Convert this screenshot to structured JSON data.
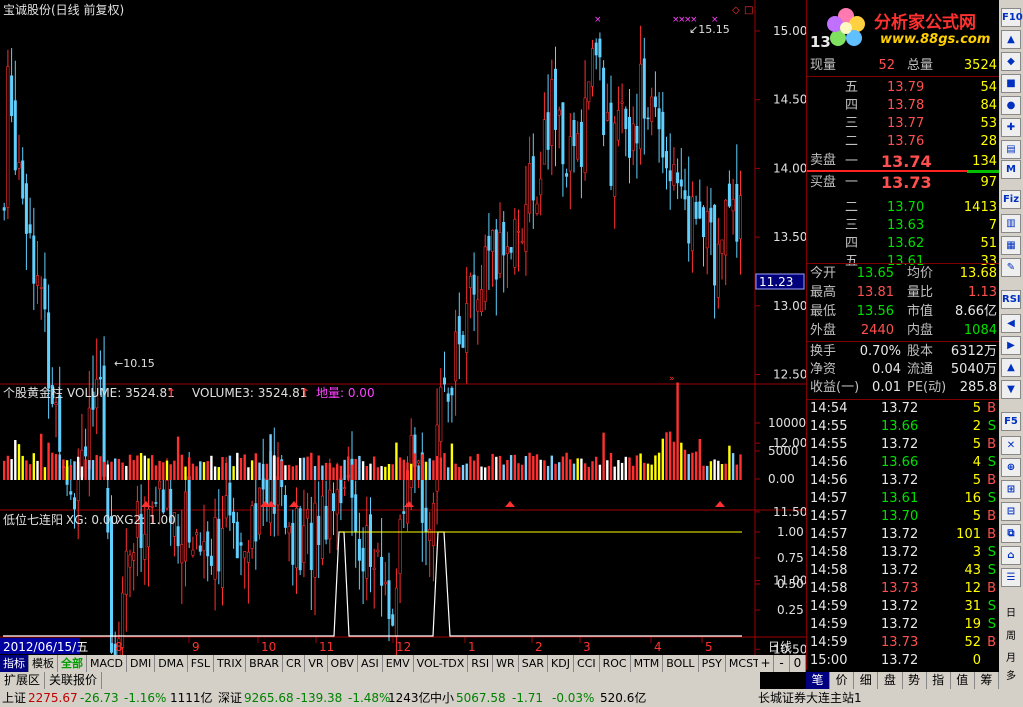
{
  "title": "宝诚股份(日线 前复权)",
  "logo": {
    "text": "分析家公式网",
    "url": "www.88gs.com"
  },
  "main_chart": {
    "price_axis": [
      "15.00",
      "14.50",
      "14.00",
      "13.50",
      "13.00",
      "12.50",
      "12.00",
      "11.50",
      "11.00",
      "10.50"
    ],
    "high_label": "15.15",
    "low_label": "10.15",
    "cursor_price": "11.23",
    "price_top": "13"
  },
  "volume_panel": {
    "label_name": "个股黄金柱",
    "label_vol": "VOLUME: 3524.81",
    "label_vol3": "VOLUME3: 3524.81",
    "label_dl": "地量: 0.00",
    "axis": [
      "10000",
      "5000",
      "0.00"
    ]
  },
  "indicator_panel": {
    "label": "低位七连阳",
    "label_xg": "XG: 0.00",
    "label_xg2": "XG2: 1.00",
    "axis": [
      "1.00",
      "0.75",
      "0.50",
      "0.25"
    ]
  },
  "date_axis": {
    "current_date": "2012/06/15/五",
    "ticks": [
      "8",
      "9",
      "10",
      "11",
      "12",
      "1",
      "2",
      "3",
      "4",
      "5"
    ],
    "period": "日线"
  },
  "chart_data": [
    {
      "type": "candlestick",
      "title": "宝诚股份(日线 前复权)",
      "ylim": [
        10.0,
        15.3
      ],
      "annotations": [
        "15.15",
        "10.15"
      ],
      "note_high": 15.15,
      "note_low": 10.15
    },
    {
      "type": "bar",
      "title": "个股黄金柱",
      "series": [
        {
          "name": "VOLUME",
          "last": 3524.81
        },
        {
          "name": "VOLUME3",
          "last": 3524.81
        },
        {
          "name": "地量",
          "last": 0.0
        }
      ],
      "ylim": [
        0,
        12000
      ]
    },
    {
      "type": "line",
      "title": "低位七连阳",
      "series": [
        {
          "name": "XG",
          "last": 0.0
        },
        {
          "name": "XG2",
          "last": 1.0
        }
      ],
      "ylim": [
        0,
        1.1
      ]
    }
  ],
  "quote": {
    "price_big": "13",
    "xianliang_label": "现量",
    "xianliang": "52",
    "zongliang_label": "总量",
    "zongliang": "3524",
    "sell": [
      {
        "level": "五",
        "price": "13.79",
        "vol": "54"
      },
      {
        "level": "四",
        "price": "13.78",
        "vol": "84"
      },
      {
        "level": "三",
        "price": "13.77",
        "vol": "53"
      },
      {
        "level": "二",
        "price": "13.76",
        "vol": "28"
      },
      {
        "level": "一",
        "price": "13.74",
        "vol": "134"
      }
    ],
    "sell_label": "卖盘",
    "buy_label": "买盘",
    "buy": [
      {
        "level": "一",
        "price": "13.73",
        "vol": "97"
      },
      {
        "level": "二",
        "price": "13.70",
        "vol": "1413"
      },
      {
        "level": "三",
        "price": "13.63",
        "vol": "7"
      },
      {
        "level": "四",
        "price": "13.62",
        "vol": "51"
      },
      {
        "level": "五",
        "price": "13.61",
        "vol": "33"
      }
    ],
    "stats": [
      {
        "l1": "今开",
        "v1": "13.65",
        "l2": "均价",
        "v2": "13.68"
      },
      {
        "l1": "最高",
        "v1": "13.81",
        "l2": "量比",
        "v2": "1.13"
      },
      {
        "l1": "最低",
        "v1": "13.56",
        "l2": "市值",
        "v2": "8.66亿"
      },
      {
        "l1": "外盘",
        "v1": "2440",
        "l2": "内盘",
        "v2": "1084"
      }
    ],
    "stats2": [
      {
        "l1": "换手",
        "v1": "0.70%",
        "l2": "股本",
        "v2": "6312万"
      },
      {
        "l1": "净资",
        "v1": "0.04",
        "l2": "流通",
        "v2": "5040万"
      },
      {
        "l1": "收益(一)",
        "v1": "0.01",
        "l2": "PE(动)",
        "v2": "285.8"
      }
    ],
    "ticks": [
      {
        "t": "14:54",
        "p": "13.72",
        "v": "5",
        "bs": "B"
      },
      {
        "t": "14:55",
        "p": "13.66",
        "v": "2",
        "bs": "S"
      },
      {
        "t": "14:55",
        "p": "13.72",
        "v": "5",
        "bs": "B"
      },
      {
        "t": "14:56",
        "p": "13.66",
        "v": "4",
        "bs": "S"
      },
      {
        "t": "14:56",
        "p": "13.72",
        "v": "5",
        "bs": "B"
      },
      {
        "t": "14:57",
        "p": "13.61",
        "v": "16",
        "bs": "S"
      },
      {
        "t": "14:57",
        "p": "13.70",
        "v": "5",
        "bs": "B"
      },
      {
        "t": "14:57",
        "p": "13.72",
        "v": "101",
        "bs": "B"
      },
      {
        "t": "14:58",
        "p": "13.72",
        "v": "3",
        "bs": "S"
      },
      {
        "t": "14:58",
        "p": "13.72",
        "v": "43",
        "bs": "S"
      },
      {
        "t": "14:58",
        "p": "13.73",
        "v": "12",
        "bs": "B"
      },
      {
        "t": "14:59",
        "p": "13.72",
        "v": "31",
        "bs": "S"
      },
      {
        "t": "14:59",
        "p": "13.72",
        "v": "19",
        "bs": "S"
      },
      {
        "t": "14:59",
        "p": "13.73",
        "v": "52",
        "bs": "B"
      },
      {
        "t": "15:00",
        "p": "13.72",
        "v": "0",
        "bs": ""
      }
    ]
  },
  "index_tabs": [
    "指标",
    "模板",
    "全部",
    "MACD",
    "DMI",
    "DMA",
    "FSL",
    "TRIX",
    "BRAR",
    "CR",
    "VR",
    "OBV",
    "ASI",
    "EMV",
    "VOL-TDX",
    "RSI",
    "WR",
    "SAR",
    "KDJ",
    "CCI",
    "ROC",
    "MTM",
    "BOLL",
    "PSY",
    "MCST"
  ],
  "zoom": [
    "+",
    "-",
    "0"
  ],
  "ext_tabs": [
    "扩展区",
    "关联报价"
  ],
  "right_tabs": [
    "笔",
    "价",
    "细",
    "盘",
    "势",
    "指",
    "值",
    "筹"
  ],
  "icons": [
    "F10",
    "M",
    "RSI",
    "Fiz",
    "F5",
    "日",
    "周",
    "月",
    "多"
  ],
  "status": {
    "sh_label": "上证",
    "sh_val": "2275.67",
    "sh_chg": "-26.73",
    "sh_pct": "-1.16%",
    "sh_amt": "1111亿",
    "sz_label": "深证",
    "sz_val": "9265.68",
    "sz_chg": "-139.38",
    "sz_pct": "-1.48%",
    "sz_amt": "1243亿",
    "zx_label": "中小",
    "zx_val": "5067.58",
    "zx_chg": "-1.71",
    "zx_pct": "-0.03%",
    "zx_amt": "520.6亿",
    "broker": "长城证券大连主站1"
  }
}
